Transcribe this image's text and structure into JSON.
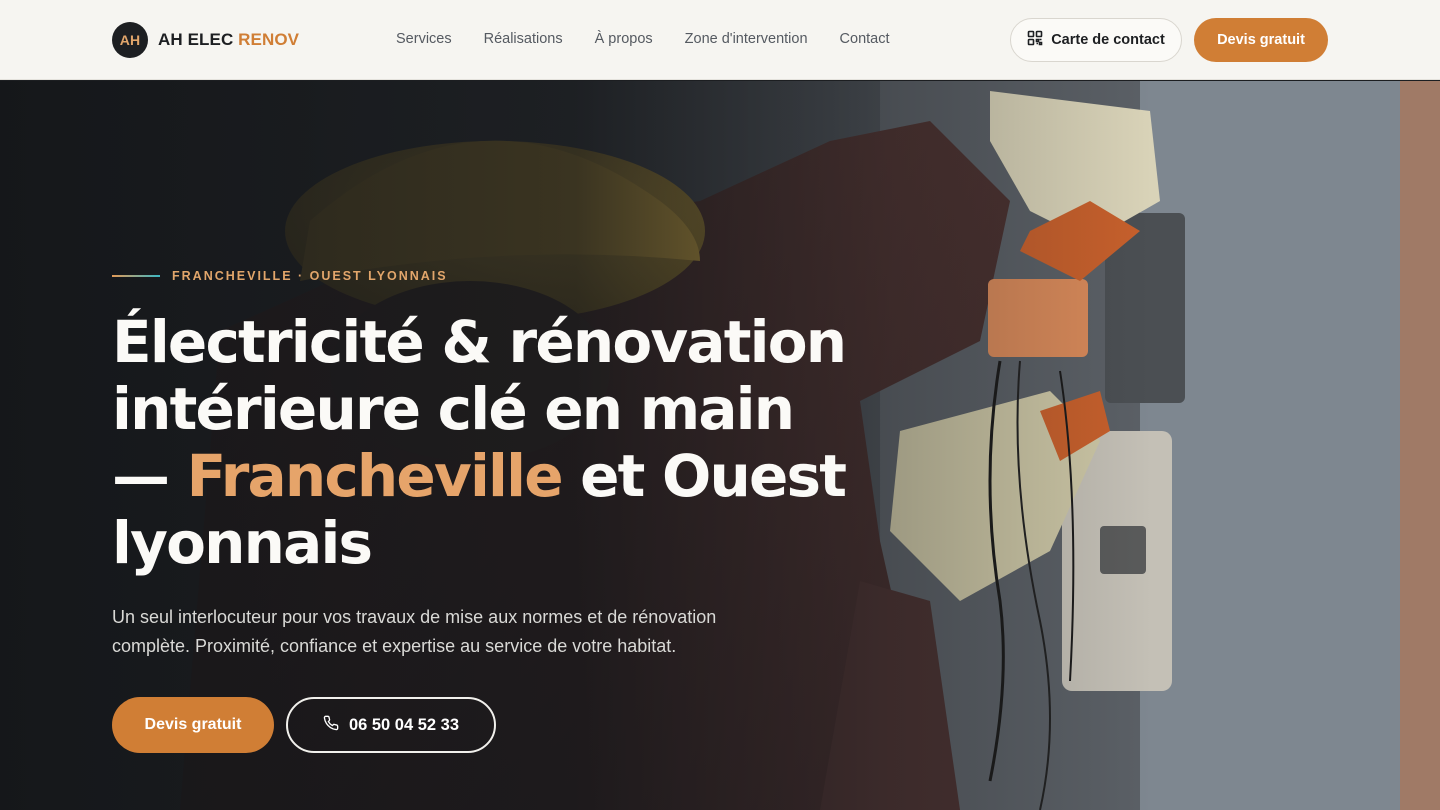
{
  "brand": {
    "logo": "AH",
    "name": "AH ELEC",
    "accent": "RENOV"
  },
  "nav": [
    {
      "label": "Services"
    },
    {
      "label": "Réalisations"
    },
    {
      "label": "À propos"
    },
    {
      "label": "Zone d'intervention"
    },
    {
      "label": "Contact"
    }
  ],
  "header_actions": {
    "contact_card_label": "Carte de contact",
    "contact_card_icon": "qr-code-icon",
    "quote_label": "Devis gratuit"
  },
  "hero": {
    "eyebrow": "FRANCHEVILLE · OUEST LYONNAIS",
    "title_part1": "Électricité & rénovation intérieure clé en main — ",
    "title_highlight": "Francheville",
    "title_part2": " et Ouest lyonnais",
    "lead": "Un seul interlocuteur pour vos travaux de mise aux normes et de rénovation complète. Proximité, confiance et expertise au service de votre habitat.",
    "cta_quote": "Devis gratuit",
    "cta_phone": "06 50 04 52 33",
    "phone_icon": "phone-icon"
  },
  "colors": {
    "accent": "#d07e35",
    "accent_light": "#e6a46a",
    "header_bg": "#f6f5f1",
    "dark": "#1d1f22",
    "teal": "#3bb7c4"
  }
}
